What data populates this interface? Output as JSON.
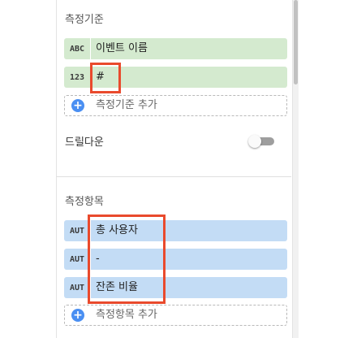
{
  "dimensions": {
    "title": "측정기준",
    "items": [
      {
        "type": "ABC",
        "label": "이벤트 이름"
      },
      {
        "type": "123",
        "label": "#"
      }
    ],
    "add_label": "측정기준 추가",
    "add_icon": "plus-circle-icon"
  },
  "drilldown": {
    "label": "드릴다운",
    "enabled": false
  },
  "metrics": {
    "title": "측정항목",
    "items": [
      {
        "type": "AUT",
        "label": "총 사용자"
      },
      {
        "type": "AUT",
        "label": "-"
      },
      {
        "type": "AUT",
        "label": "잔존 비율"
      }
    ],
    "add_label": "측정항목 추가",
    "add_icon": "plus-circle-icon"
  },
  "colors": {
    "dimension_chip": "#d4eacf",
    "metric_chip": "#c3dcf5",
    "add_icon": "#4a8ff2",
    "highlight": "#e94a2d"
  }
}
